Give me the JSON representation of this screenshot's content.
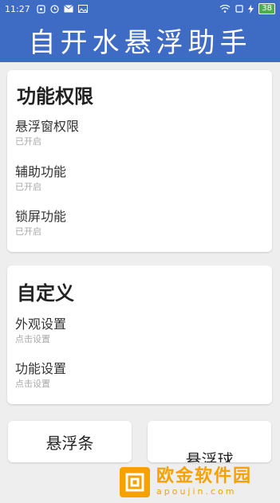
{
  "status_bar": {
    "time": "11:27",
    "battery": "38",
    "left_icons": [
      "notification-icon",
      "clock-icon",
      "mail-icon",
      "image-icon"
    ],
    "right_icons": [
      "wifi-icon",
      "screen-icon",
      "charging-icon"
    ]
  },
  "header": {
    "title": "自开水悬浮助手",
    "background": "#3e6bc4"
  },
  "card_permissions": {
    "title": "功能权限",
    "items": [
      {
        "label": "悬浮窗权限",
        "status": "已开启"
      },
      {
        "label": "辅助功能",
        "status": "已开启"
      },
      {
        "label": "锁屏功能",
        "status": "已开启"
      }
    ]
  },
  "card_custom": {
    "title": "自定义",
    "items": [
      {
        "label": "外观设置",
        "status": "点击设置"
      },
      {
        "label": "功能设置",
        "status": "点击设置"
      }
    ]
  },
  "buttons": {
    "left": "悬浮条",
    "right": "悬浮球"
  },
  "watermark": {
    "name": "欧金软件园",
    "url": "apoujin.com",
    "color": "#f5a100"
  }
}
